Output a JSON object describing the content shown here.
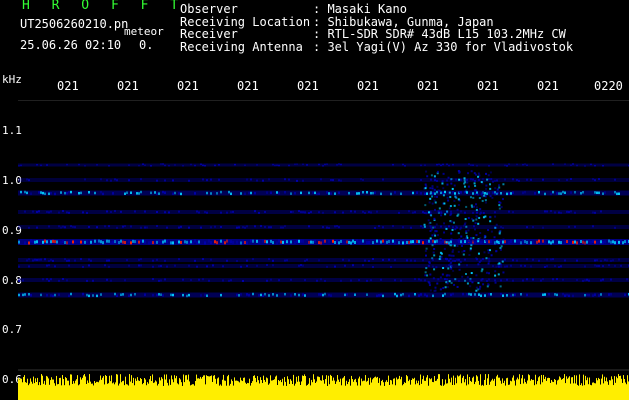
{
  "header": {
    "logo": "H R O F F T",
    "filename": "UT2506260210.pn",
    "tag": "meteor",
    "datetime": "25.06.26 02:10",
    "count": "0.",
    "fields": [
      {
        "label": "Observer",
        "sep": ": ",
        "value": "Masaki Kano"
      },
      {
        "label": "Receiving Location",
        "sep": ": ",
        "value": "Shibukawa, Gunma, Japan"
      },
      {
        "label": "Receiver",
        "sep": ": ",
        "value": "RTL-SDR SDR# 43dB L15 103.2MHz CW"
      },
      {
        "label": "Receiving Antenna",
        "sep": ": ",
        "value": "3el Yagi(V) Az 330 for Vladivostok"
      }
    ]
  },
  "axis": {
    "unit": "kHz",
    "y_ticks": [
      "1.1",
      "1.0",
      "0.9",
      "0.8",
      "0.7",
      "0.6"
    ],
    "x_ticks": [
      "021",
      "021",
      "021",
      "021",
      "021",
      "021",
      "021",
      "021",
      "021",
      "0220"
    ]
  },
  "colors": {
    "background": "#000000",
    "text": "#ffffff",
    "logo": "#33ff33",
    "signal_low": "#0000aa",
    "signal_mid": "#00ccff",
    "signal_high": "#ff2200",
    "amplitude": "#ffee00",
    "grid": "#ffffff"
  }
}
